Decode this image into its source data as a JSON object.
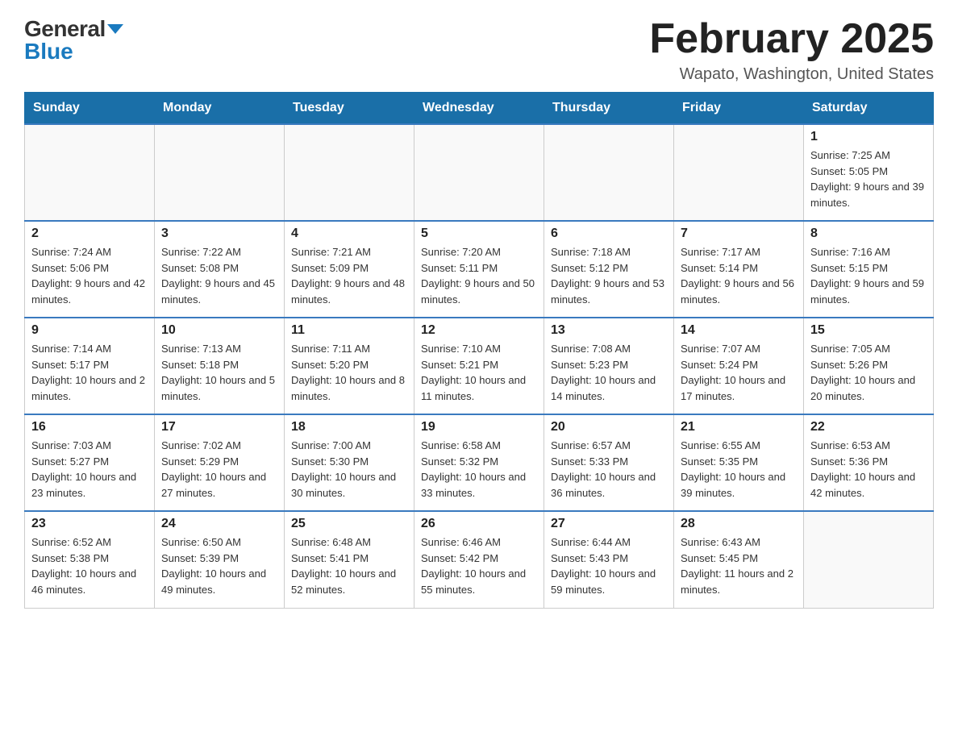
{
  "logo": {
    "general": "General",
    "blue": "Blue"
  },
  "title": "February 2025",
  "subtitle": "Wapato, Washington, United States",
  "days_of_week": [
    "Sunday",
    "Monday",
    "Tuesday",
    "Wednesday",
    "Thursday",
    "Friday",
    "Saturday"
  ],
  "weeks": [
    [
      {
        "day": "",
        "info": ""
      },
      {
        "day": "",
        "info": ""
      },
      {
        "day": "",
        "info": ""
      },
      {
        "day": "",
        "info": ""
      },
      {
        "day": "",
        "info": ""
      },
      {
        "day": "",
        "info": ""
      },
      {
        "day": "1",
        "info": "Sunrise: 7:25 AM\nSunset: 5:05 PM\nDaylight: 9 hours and 39 minutes."
      }
    ],
    [
      {
        "day": "2",
        "info": "Sunrise: 7:24 AM\nSunset: 5:06 PM\nDaylight: 9 hours and 42 minutes."
      },
      {
        "day": "3",
        "info": "Sunrise: 7:22 AM\nSunset: 5:08 PM\nDaylight: 9 hours and 45 minutes."
      },
      {
        "day": "4",
        "info": "Sunrise: 7:21 AM\nSunset: 5:09 PM\nDaylight: 9 hours and 48 minutes."
      },
      {
        "day": "5",
        "info": "Sunrise: 7:20 AM\nSunset: 5:11 PM\nDaylight: 9 hours and 50 minutes."
      },
      {
        "day": "6",
        "info": "Sunrise: 7:18 AM\nSunset: 5:12 PM\nDaylight: 9 hours and 53 minutes."
      },
      {
        "day": "7",
        "info": "Sunrise: 7:17 AM\nSunset: 5:14 PM\nDaylight: 9 hours and 56 minutes."
      },
      {
        "day": "8",
        "info": "Sunrise: 7:16 AM\nSunset: 5:15 PM\nDaylight: 9 hours and 59 minutes."
      }
    ],
    [
      {
        "day": "9",
        "info": "Sunrise: 7:14 AM\nSunset: 5:17 PM\nDaylight: 10 hours and 2 minutes."
      },
      {
        "day": "10",
        "info": "Sunrise: 7:13 AM\nSunset: 5:18 PM\nDaylight: 10 hours and 5 minutes."
      },
      {
        "day": "11",
        "info": "Sunrise: 7:11 AM\nSunset: 5:20 PM\nDaylight: 10 hours and 8 minutes."
      },
      {
        "day": "12",
        "info": "Sunrise: 7:10 AM\nSunset: 5:21 PM\nDaylight: 10 hours and 11 minutes."
      },
      {
        "day": "13",
        "info": "Sunrise: 7:08 AM\nSunset: 5:23 PM\nDaylight: 10 hours and 14 minutes."
      },
      {
        "day": "14",
        "info": "Sunrise: 7:07 AM\nSunset: 5:24 PM\nDaylight: 10 hours and 17 minutes."
      },
      {
        "day": "15",
        "info": "Sunrise: 7:05 AM\nSunset: 5:26 PM\nDaylight: 10 hours and 20 minutes."
      }
    ],
    [
      {
        "day": "16",
        "info": "Sunrise: 7:03 AM\nSunset: 5:27 PM\nDaylight: 10 hours and 23 minutes."
      },
      {
        "day": "17",
        "info": "Sunrise: 7:02 AM\nSunset: 5:29 PM\nDaylight: 10 hours and 27 minutes."
      },
      {
        "day": "18",
        "info": "Sunrise: 7:00 AM\nSunset: 5:30 PM\nDaylight: 10 hours and 30 minutes."
      },
      {
        "day": "19",
        "info": "Sunrise: 6:58 AM\nSunset: 5:32 PM\nDaylight: 10 hours and 33 minutes."
      },
      {
        "day": "20",
        "info": "Sunrise: 6:57 AM\nSunset: 5:33 PM\nDaylight: 10 hours and 36 minutes."
      },
      {
        "day": "21",
        "info": "Sunrise: 6:55 AM\nSunset: 5:35 PM\nDaylight: 10 hours and 39 minutes."
      },
      {
        "day": "22",
        "info": "Sunrise: 6:53 AM\nSunset: 5:36 PM\nDaylight: 10 hours and 42 minutes."
      }
    ],
    [
      {
        "day": "23",
        "info": "Sunrise: 6:52 AM\nSunset: 5:38 PM\nDaylight: 10 hours and 46 minutes."
      },
      {
        "day": "24",
        "info": "Sunrise: 6:50 AM\nSunset: 5:39 PM\nDaylight: 10 hours and 49 minutes."
      },
      {
        "day": "25",
        "info": "Sunrise: 6:48 AM\nSunset: 5:41 PM\nDaylight: 10 hours and 52 minutes."
      },
      {
        "day": "26",
        "info": "Sunrise: 6:46 AM\nSunset: 5:42 PM\nDaylight: 10 hours and 55 minutes."
      },
      {
        "day": "27",
        "info": "Sunrise: 6:44 AM\nSunset: 5:43 PM\nDaylight: 10 hours and 59 minutes."
      },
      {
        "day": "28",
        "info": "Sunrise: 6:43 AM\nSunset: 5:45 PM\nDaylight: 11 hours and 2 minutes."
      },
      {
        "day": "",
        "info": ""
      }
    ]
  ]
}
